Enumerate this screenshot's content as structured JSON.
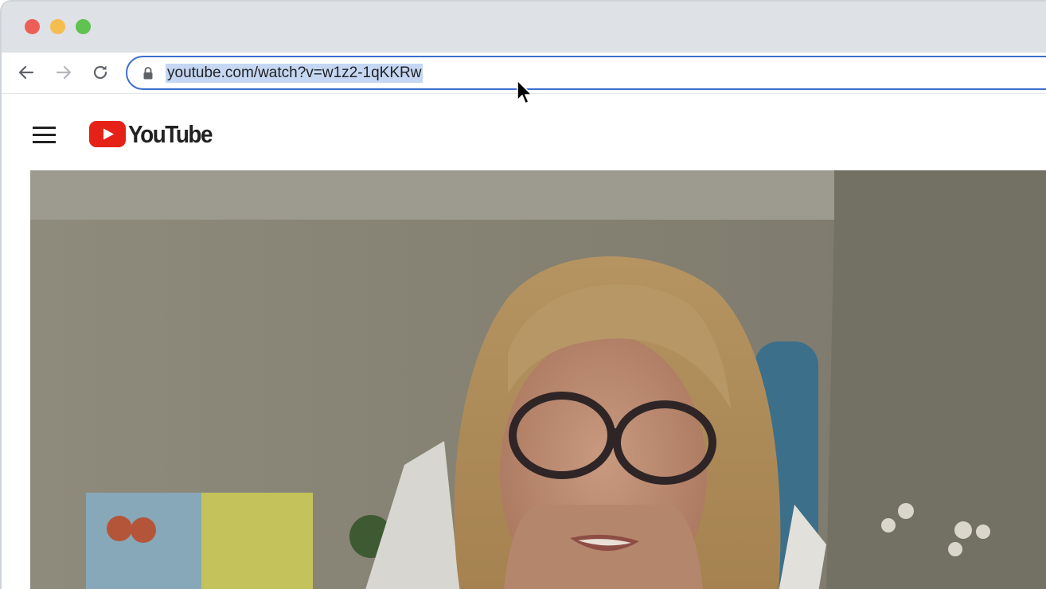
{
  "browser": {
    "url": "youtube.com/watch?v=w1z2-1qKKRw"
  },
  "youtube": {
    "logo_text": "YouTube"
  },
  "colors": {
    "accent": "#3c6fd1",
    "selection": "#c5d7f2",
    "youtube_red": "#e62117"
  },
  "icons": [
    "back-arrow-icon",
    "forward-arrow-icon",
    "reload-icon",
    "lock-icon",
    "hamburger-menu-icon",
    "youtube-play-icon",
    "mouse-cursor-icon"
  ]
}
